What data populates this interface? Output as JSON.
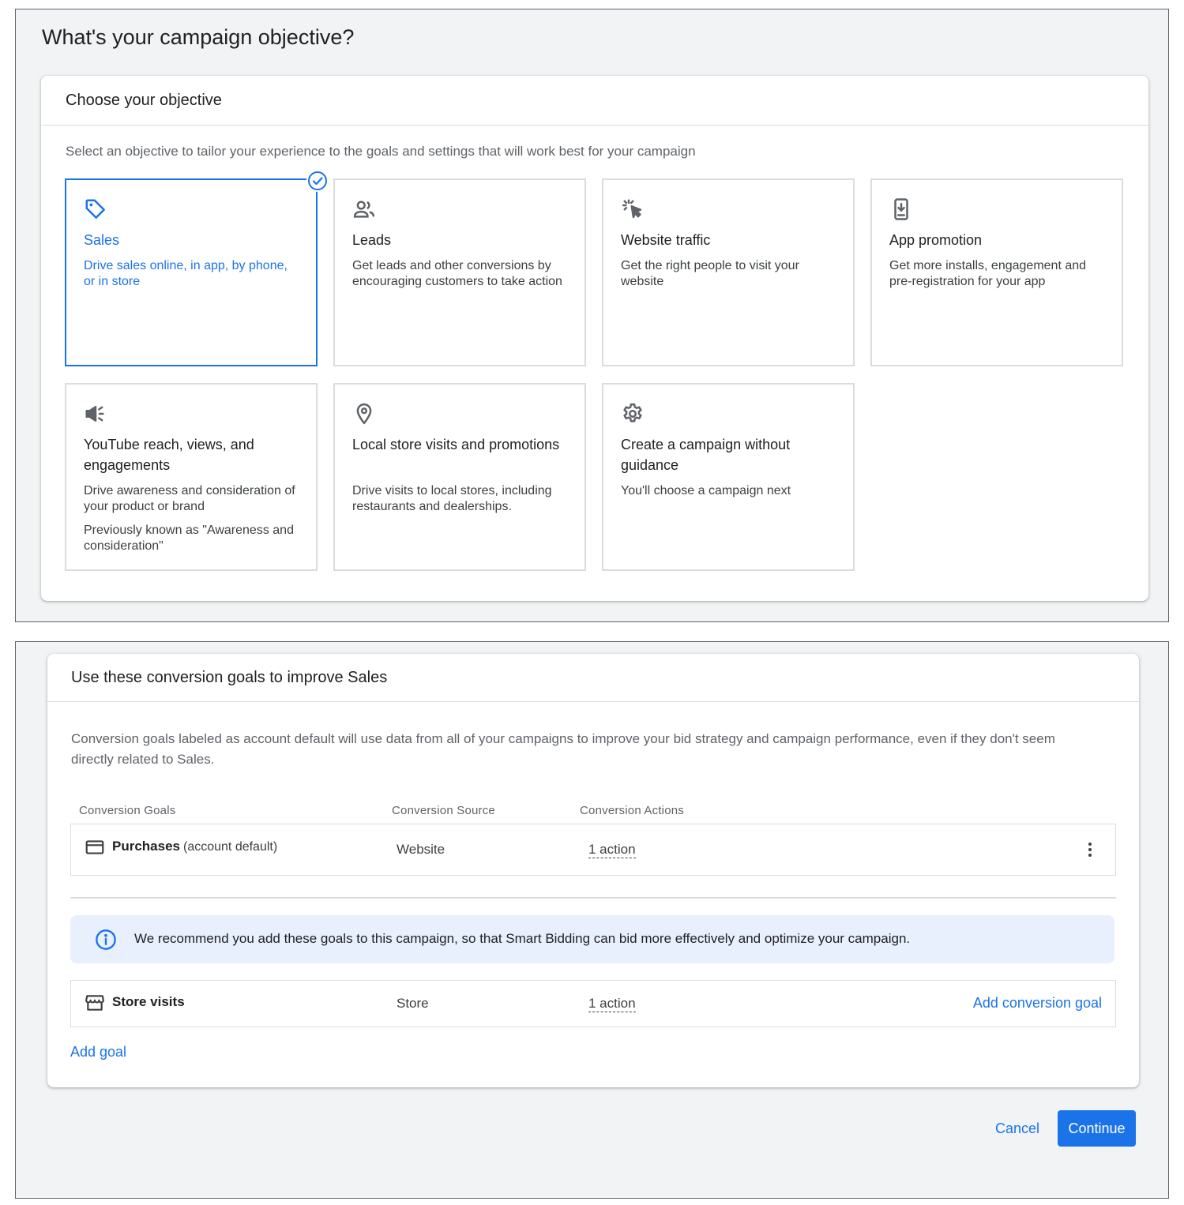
{
  "page": {
    "title": "What's your campaign objective?"
  },
  "objective_card": {
    "header": "Choose your objective",
    "description": "Select an objective to tailor your experience to the goals and settings that will work best for your campaign",
    "tiles": [
      {
        "icon": "tag-icon",
        "title": "Sales",
        "text": "Drive sales online, in app, by phone, or in store",
        "selected": true
      },
      {
        "icon": "people-icon",
        "title": "Leads",
        "text": "Get leads and other conversions by encouraging customers to take action",
        "selected": false
      },
      {
        "icon": "cursor-click-icon",
        "title": "Website traffic",
        "text": "Get the right people to visit your website",
        "selected": false
      },
      {
        "icon": "phone-download-icon",
        "title": "App promotion",
        "text": "Get more installs, engagement and pre-registration for your app",
        "selected": false
      },
      {
        "icon": "megaphone-icon",
        "title": "YouTube reach, views, and engagements",
        "text": "Drive awareness and consideration of your product or brand",
        "note": "Previously known as \"Awareness and consideration\"",
        "selected": false
      },
      {
        "icon": "location-pin-icon",
        "title": "Local store visits and promotions",
        "text": "Drive visits to local stores, including restaurants and dealerships.",
        "selected": false
      },
      {
        "icon": "gear-icon",
        "title": "Create a campaign without guidance",
        "text": "You'll choose a campaign next",
        "selected": false
      }
    ]
  },
  "goals_card": {
    "header": "Use these conversion goals to improve Sales",
    "description": "Conversion goals labeled as account default will use data from all of your campaigns to improve your bid strategy and campaign performance, even if they don't seem directly related to Sales.",
    "columns": {
      "goals": "Conversion Goals",
      "source": "Conversion Source",
      "actions": "Conversion Actions"
    },
    "rows": [
      {
        "icon": "credit-card-icon",
        "name": "Purchases",
        "suffix": "(account default)",
        "source": "Website",
        "actions": "1 action"
      }
    ],
    "recommendation": "We recommend you add these goals to this campaign, so that Smart Bidding can bid more effectively and optimize your campaign.",
    "recommended_rows": [
      {
        "icon": "storefront-icon",
        "name": "Store visits",
        "source": "Store",
        "actions": "1 action",
        "link": "Add conversion goal"
      }
    ],
    "add_goal": "Add goal"
  },
  "footer": {
    "cancel": "Cancel",
    "continue": "Continue"
  },
  "colors": {
    "accent": "#1a73e8",
    "panel_background": "#f1f3f4",
    "info_background": "#e8f0fe",
    "border": "#dadce0"
  }
}
